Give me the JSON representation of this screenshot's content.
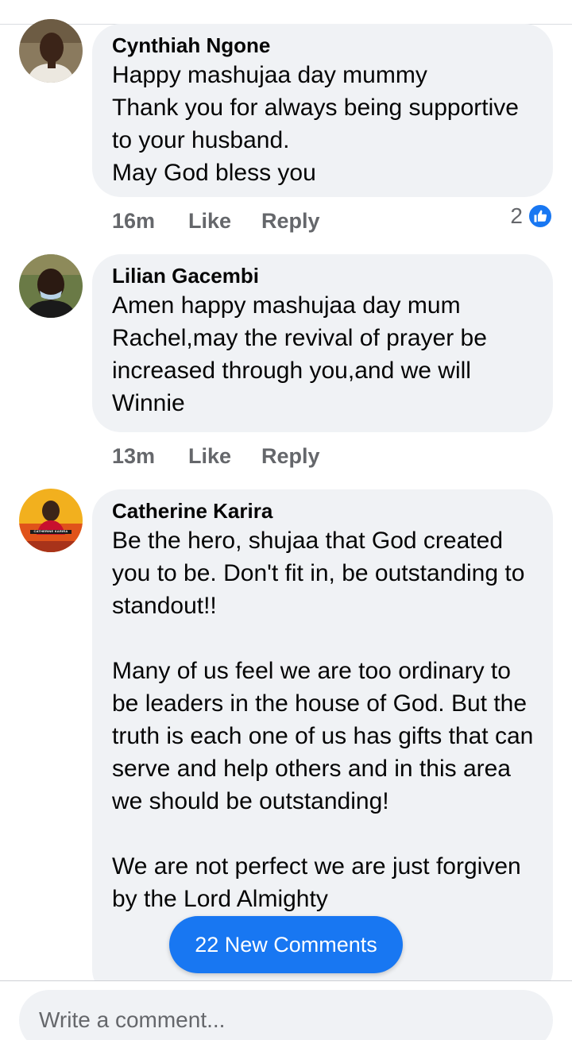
{
  "comments": [
    {
      "author": "Cynthiah Ngone",
      "text": "Happy mashujaa day mummy\nThank you for always being supportive to your husband.\nMay God bless you",
      "time": "16m",
      "like_label": "Like",
      "reply_label": "Reply",
      "reaction_count": "2",
      "reaction_icon": "thumbs-up-icon",
      "avatar_colors": {
        "bg": "#7a6a52",
        "face": "#3b2418",
        "shirt": "#e9e4dc"
      }
    },
    {
      "author": "Lilian Gacembi",
      "text": "Amen happy mashujaa day mum Rachel,may the revival of prayer be increased through you,and we will Winnie",
      "time": "13m",
      "like_label": "Like",
      "reply_label": "Reply",
      "avatar_colors": {
        "bg": "#5b6e3a",
        "face": "#2b1a12",
        "shirt": "#1a1a1a"
      }
    },
    {
      "author": "Catherine Karira",
      "text": "Be the hero, shujaa that God created you to be. Don't fit in, be outstanding to standout!!\n\nMany of us feel we are too ordinary to be leaders in  the house of God. But the truth is each one of us has gifts that can serve and help others and in this area we should be outstanding!\n\nWe are not perfect we are just forgiven by the Lord Almighty",
      "avatar_caption": "CATHERINE KARIRA",
      "avatar_colors": {
        "bg": "#f2b01e",
        "face": "#3b2418",
        "shirt": "#c8102e"
      }
    }
  ],
  "new_comments_label": "22 New Comments",
  "composer": {
    "placeholder": "Write a comment..."
  },
  "colors": {
    "accent": "#1877f2",
    "bubble": "#f0f2f5",
    "muted": "#65676b"
  }
}
